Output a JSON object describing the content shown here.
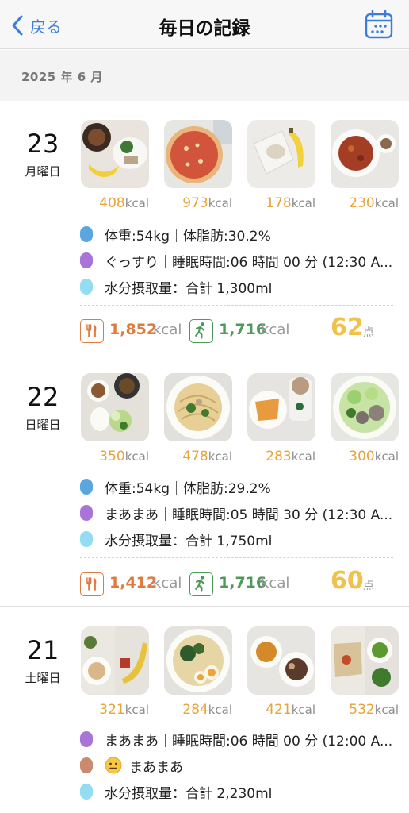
{
  "nav": {
    "back_label": "戻る",
    "title": "毎日の記録"
  },
  "month_label": "2025 年 6 月",
  "days": [
    {
      "date": "23",
      "weekday": "月曜日",
      "meals": [
        {
          "kcal": "408",
          "unit": "kcal"
        },
        {
          "kcal": "973",
          "unit": "kcal"
        },
        {
          "kcal": "178",
          "unit": "kcal"
        },
        {
          "kcal": "230",
          "unit": "kcal"
        }
      ],
      "rows": [
        {
          "dot": "#5ca6df",
          "text": "体重:54kg｜体脂肪:30.2%"
        },
        {
          "dot": "#a874d8",
          "text": "ぐっすり｜睡眠時間:06 時間 00 分 (12:30 A..."
        },
        {
          "dot": "#93dcf2",
          "text": "水分摂取量：合計 1,300ml"
        }
      ],
      "intake": "1,852",
      "intake_unit": "kcal",
      "burn": "1,716",
      "burn_unit": "kcal",
      "score": "62",
      "score_unit": "点"
    },
    {
      "date": "22",
      "weekday": "日曜日",
      "meals": [
        {
          "kcal": "350",
          "unit": "kcal"
        },
        {
          "kcal": "478",
          "unit": "kcal"
        },
        {
          "kcal": "283",
          "unit": "kcal"
        },
        {
          "kcal": "300",
          "unit": "kcal"
        }
      ],
      "rows": [
        {
          "dot": "#5ca6df",
          "text": "体重:54kg｜体脂肪:29.2%"
        },
        {
          "dot": "#a874d8",
          "text": "まあまあ｜睡眠時間:05 時間 30 分 (12:30 A..."
        },
        {
          "dot": "#93dcf2",
          "text": "水分摂取量：合計 1,750ml"
        }
      ],
      "intake": "1,412",
      "intake_unit": "kcal",
      "burn": "1,716",
      "burn_unit": "kcal",
      "score": "60",
      "score_unit": "点"
    },
    {
      "date": "21",
      "weekday": "土曜日",
      "meals": [
        {
          "kcal": "321",
          "unit": "kcal"
        },
        {
          "kcal": "284",
          "unit": "kcal"
        },
        {
          "kcal": "421",
          "unit": "kcal"
        },
        {
          "kcal": "532",
          "unit": "kcal"
        }
      ],
      "rows": [
        {
          "dot": "#a874d8",
          "text": "まあまあ｜睡眠時間:06 時間 00 分 (12:00 A..."
        },
        {
          "dot": "#c98a6f",
          "emoji": "neutral-face-icon",
          "text": "まあまあ"
        },
        {
          "dot": "#93dcf2",
          "text": "水分摂取量：合計 2,230ml"
        }
      ]
    }
  ],
  "colors": {
    "accent_blue": "#3b7ddd",
    "kcal_orange": "#e8a339",
    "intake_red": "#e07a3f",
    "exercise_green": "#4f9a5a",
    "score_yellow": "#f0c14b"
  }
}
